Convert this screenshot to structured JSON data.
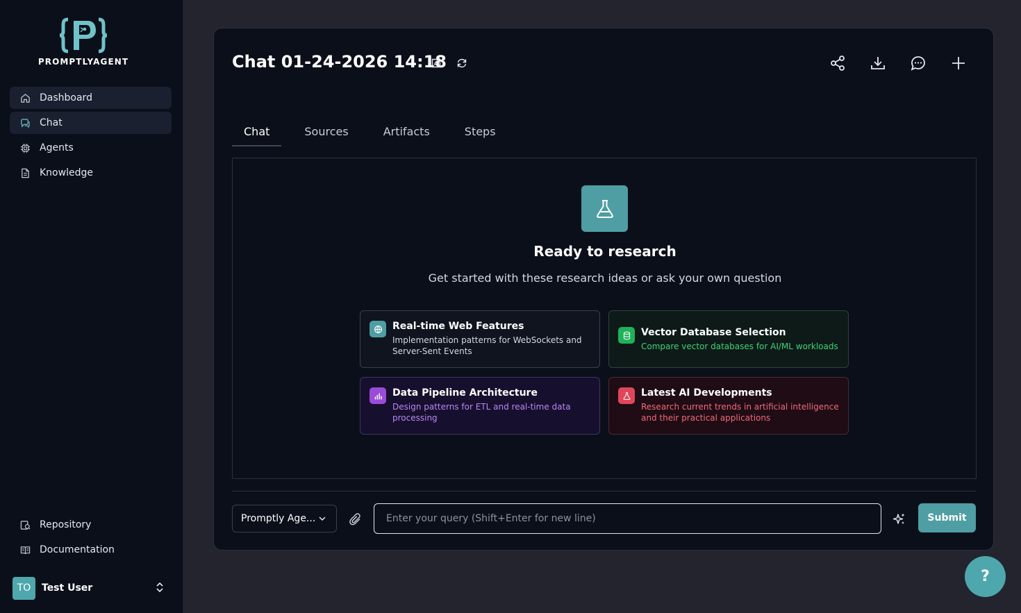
{
  "brand": {
    "name": "PROMPTLYAGENT"
  },
  "sidebar": {
    "items": [
      {
        "label": "Dashboard",
        "icon": "home-icon",
        "active": true
      },
      {
        "label": "Chat",
        "icon": "chat-icon",
        "active": true
      },
      {
        "label": "Agents",
        "icon": "cpu-icon",
        "active": false
      },
      {
        "label": "Knowledge",
        "icon": "document-icon",
        "active": false
      }
    ],
    "bottom_items": [
      {
        "label": "Repository",
        "icon": "repository-icon"
      },
      {
        "label": "Documentation",
        "icon": "book-icon"
      }
    ],
    "user": {
      "initials": "TO",
      "name": "Test User"
    }
  },
  "header": {
    "title": "Chat 01-24-2026 14:18",
    "actions": [
      "share-icon",
      "download-icon",
      "message-icon",
      "plus-icon"
    ]
  },
  "tabs": [
    {
      "label": "Chat",
      "active": true
    },
    {
      "label": "Sources",
      "active": false
    },
    {
      "label": "Artifacts",
      "active": false
    },
    {
      "label": "Steps",
      "active": false
    }
  ],
  "hero": {
    "icon": "flask-icon",
    "title": "Ready to research",
    "subtitle": "Get started with these research ideas or ask your own question"
  },
  "suggestions": [
    {
      "title": "Real-time Web Features",
      "description": "Implementation patterns for WebSockets and Server-Sent Events",
      "icon": "globe-icon",
      "color": "#4e9ea4"
    },
    {
      "title": "Vector Database Selection",
      "description": "Compare vector databases for AI/ML workloads",
      "icon": "database-icon",
      "color": "#1fb25a"
    },
    {
      "title": "Data Pipeline Architecture",
      "description": "Design patterns for ETL and real-time data processing",
      "icon": "bar-chart-icon",
      "color": "#9a4bd8"
    },
    {
      "title": "Latest AI Developments",
      "description": "Research current trends in artificial intelligence and their practical applications",
      "icon": "flask-icon",
      "color": "#e0465a"
    }
  ],
  "composer": {
    "agent": "Promptly Age...",
    "placeholder": "Enter your query (Shift+Enter for new line)",
    "submit_label": "Submit"
  },
  "help": {
    "label": "?"
  },
  "colors": {
    "accent": "#4e9ea4",
    "sidebar_bg": "#0b0f1a",
    "page_bg": "#23242e"
  }
}
